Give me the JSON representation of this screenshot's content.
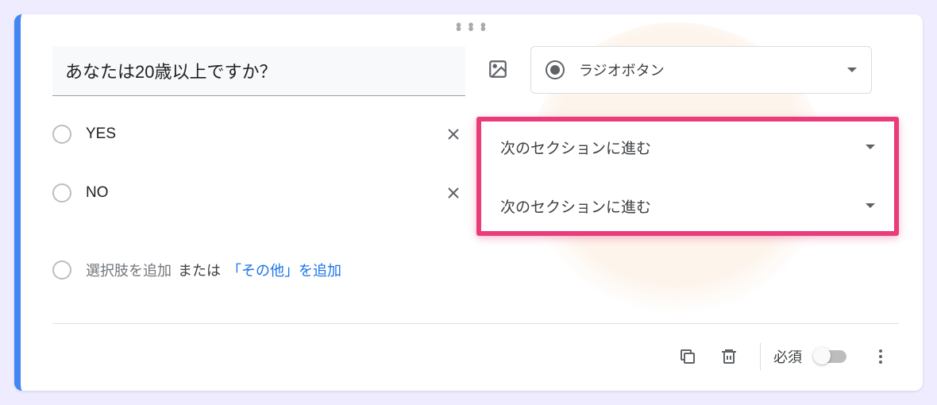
{
  "question": {
    "text": "あなたは20歳以上ですか？",
    "type_label": "ラジオボタン"
  },
  "options": [
    {
      "label": "YES",
      "section_goto": "次のセクションに進む"
    },
    {
      "label": "NO",
      "section_goto": "次のセクションに進む"
    }
  ],
  "add_row": {
    "placeholder": "選択肢を追加",
    "or_text": "または",
    "add_other": "「その他」を追加"
  },
  "footer": {
    "required_label": "必須",
    "required_on": false
  }
}
